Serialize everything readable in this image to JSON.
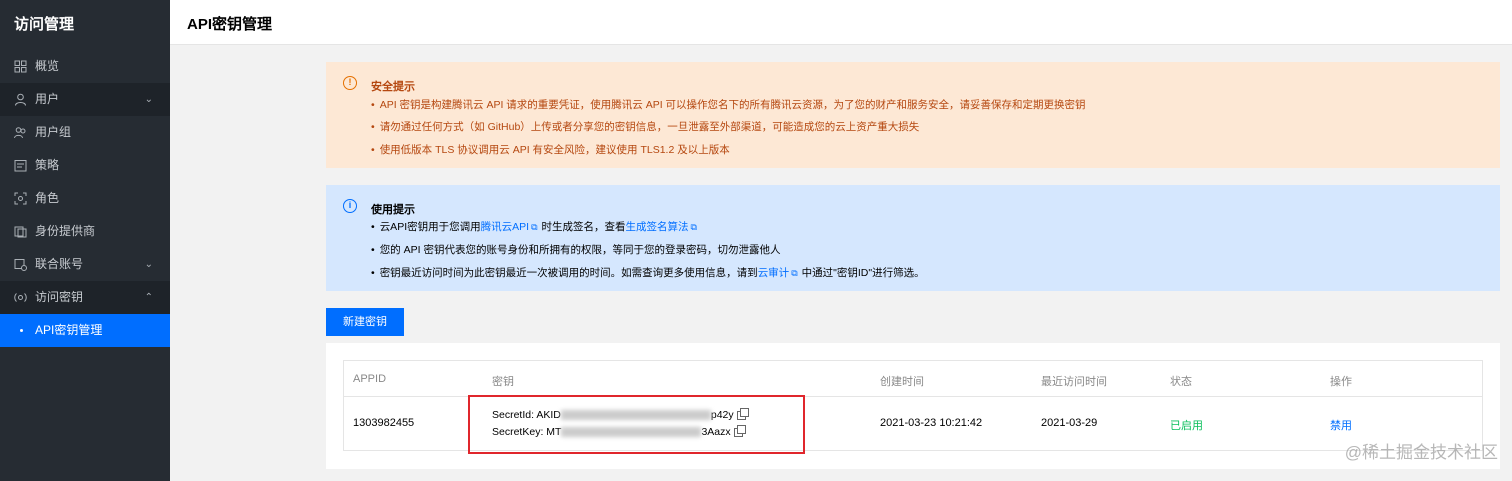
{
  "sidebar": {
    "title": "访问管理",
    "items": [
      {
        "label": "概览",
        "icon": "grid-icon"
      },
      {
        "label": "用户",
        "icon": "user-icon",
        "chevron": "⌄"
      },
      {
        "label": "用户组",
        "icon": "user-group-icon"
      },
      {
        "label": "策略",
        "icon": "policy-icon"
      },
      {
        "label": "角色",
        "icon": "role-icon"
      },
      {
        "label": "身份提供商",
        "icon": "identity-provider-icon"
      },
      {
        "label": "联合账号",
        "icon": "federated-account-icon",
        "chevron": "⌄"
      },
      {
        "label": "访问密钥",
        "icon": "key-icon",
        "chevron": "⌃"
      },
      {
        "label": "API密钥管理",
        "icon": "dot-icon"
      }
    ]
  },
  "header": {
    "title": "API密钥管理"
  },
  "security_alert": {
    "title": "安全提示",
    "lines": [
      "API 密钥是构建腾讯云 API 请求的重要凭证，使用腾讯云 API 可以操作您名下的所有腾讯云资源，为了您的财产和服务安全，请妥善保存和定期更换密钥",
      "请勿通过任何方式（如 GitHub）上传或者分享您的密钥信息，一旦泄露至外部渠道，可能造成您的云上资产重大损失",
      "使用低版本 TLS 协议调用云 API 有安全风险，建议使用 TLS1.2 及以上版本"
    ]
  },
  "usage_alert": {
    "title": "使用提示",
    "line1_pre": "云API密钥用于您调用",
    "line1_link1": "腾讯云API",
    "line1_mid": "时生成签名，查看",
    "line1_link2": "生成签名算法",
    "line2": "您的 API 密钥代表您的账号身份和所拥有的权限，等同于您的登录密码，切勿泄露他人",
    "line3_pre": "密钥最近访问时间为此密钥最近一次被调用的时间。如需查询更多使用信息，请到",
    "line3_link": "云审计",
    "line3_post": "中通过\"密钥ID\"进行筛选。"
  },
  "new_key_button": "新建密钥",
  "table": {
    "columns": [
      "APPID",
      "密钥",
      "创建时间",
      "最近访问时间",
      "状态",
      "操作"
    ],
    "rows": [
      {
        "appid": "1303982455",
        "secret_id_label": "SecretId: AKID",
        "secret_id_tail": "p42y",
        "secret_key_label": "SecretKey: MT",
        "secret_key_tail": "3Aazx",
        "created": "2021-03-23 10:21:42",
        "last_access": "2021-03-29",
        "status": "已启用",
        "action": "禁用"
      }
    ]
  },
  "watermark": "@稀土掘金技术社区",
  "colors": {
    "primary": "#006eff",
    "sidebar": "#262c33",
    "warning_bg": "#fde8d5",
    "info_bg": "#d5e7fe",
    "status_on": "#0abf5b",
    "highlight": "#e0262c"
  }
}
